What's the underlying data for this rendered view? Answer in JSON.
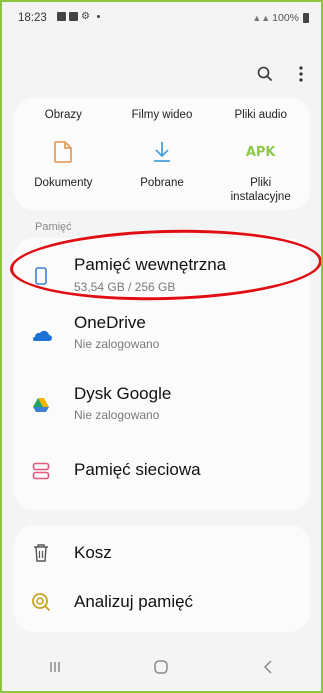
{
  "status_bar": {
    "time": "18:23",
    "right_text": "100%",
    "notification_icons": [
      "gallery-icon",
      "photo-icon",
      "settings-icon"
    ]
  },
  "toolbar": {
    "search_icon": "search-icon",
    "more_icon": "more-vertical-icon"
  },
  "categories": {
    "row1": [
      "Obrazy",
      "Filmy wideo",
      "Pliki audio"
    ],
    "row2": [
      {
        "label": "Dokumenty",
        "icon": "document-icon"
      },
      {
        "label": "Pobrane",
        "icon": "download-icon"
      },
      {
        "label": "Pliki\ninstalacyjne",
        "icon": "apk-icon",
        "icon_text": "APK"
      }
    ]
  },
  "storage": {
    "section_label": "Pamięć",
    "items": [
      {
        "title": "Pamięć wewnętrzna",
        "subtitle": "53,54 GB / 256 GB",
        "icon": "phone-icon"
      },
      {
        "title": "OneDrive",
        "subtitle": "Nie zalogowano",
        "icon": "onedrive-icon"
      },
      {
        "title": "Dysk Google",
        "subtitle": "Nie zalogowano",
        "icon": "google-drive-icon"
      },
      {
        "title": "Pamięć sieciowa",
        "icon": "network-storage-icon"
      }
    ]
  },
  "tools": {
    "items": [
      {
        "title": "Kosz",
        "icon": "trash-icon"
      },
      {
        "title": "Analizuj pamięć",
        "icon": "analyze-storage-icon"
      }
    ]
  },
  "navigation": {
    "recent": "recent-apps-icon",
    "home": "home-icon",
    "back": "back-icon"
  },
  "colors": {
    "frame": "#8dc540",
    "background": "#f4f4f4",
    "card": "#fbfbfb",
    "highlight_ellipse": "#e10d12",
    "accent_blue": "#3b7fd6",
    "apk_green": "#8cc94b"
  }
}
